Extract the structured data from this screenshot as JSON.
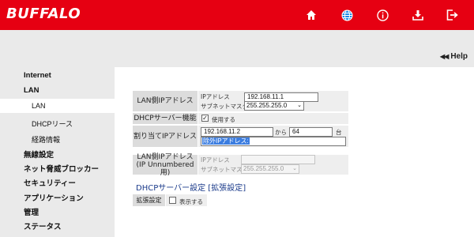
{
  "header": {
    "logo": "BUFFALO",
    "icons": [
      "home-icon",
      "globe-icon",
      "info-icon",
      "download-icon",
      "logout-icon"
    ],
    "brand_color": "#e60012",
    "accent_color": "#1e88e5"
  },
  "help": {
    "arrows": "◀◀",
    "label": "Help"
  },
  "sidebar": {
    "items": [
      {
        "label": "Internet",
        "level": 1
      },
      {
        "label": "LAN",
        "level": 1
      },
      {
        "label": "LAN",
        "level": 2,
        "active": true
      },
      {
        "label": "DHCPリース",
        "level": 2
      },
      {
        "label": "経路情報",
        "level": 2
      },
      {
        "label": "無線設定",
        "level": 1
      },
      {
        "label": "ネット脅威ブロッカー",
        "level": 1
      },
      {
        "label": "セキュリティー",
        "level": 1
      },
      {
        "label": "アプリケーション",
        "level": 1
      },
      {
        "label": "管理",
        "level": 1
      },
      {
        "label": "ステータス",
        "level": 1
      }
    ]
  },
  "form": {
    "lan_ip": {
      "label": "LAN側IPアドレス",
      "ip_label": "IPアドレス",
      "ip_value": "192.168.11.1",
      "mask_label": "サブネットマスク",
      "mask_value": "255.255.255.0"
    },
    "dhcp": {
      "label": "DHCPサーバー機能",
      "checkbox_label": "使用する",
      "checked": true
    },
    "assign": {
      "label": "割り当てIPアドレス",
      "start_value": "192.168.11.2",
      "from_text": "から",
      "count_value": "64",
      "unit_text": "台",
      "exclude_label": "除外IPアドレス:"
    },
    "unnumbered": {
      "label_line1": "LAN側IPアドレス",
      "label_line2": "(IP Unnumbered用)",
      "ip_label": "IPアドレス",
      "ip_value": "",
      "mask_label": "サブネットマスク",
      "mask_value": "255.255.255.0"
    },
    "dhcp_ext": {
      "title": "DHCPサーバー設定 [拡張設定]",
      "label": "拡張設定",
      "checkbox_label": "表示する",
      "checked": false
    }
  }
}
